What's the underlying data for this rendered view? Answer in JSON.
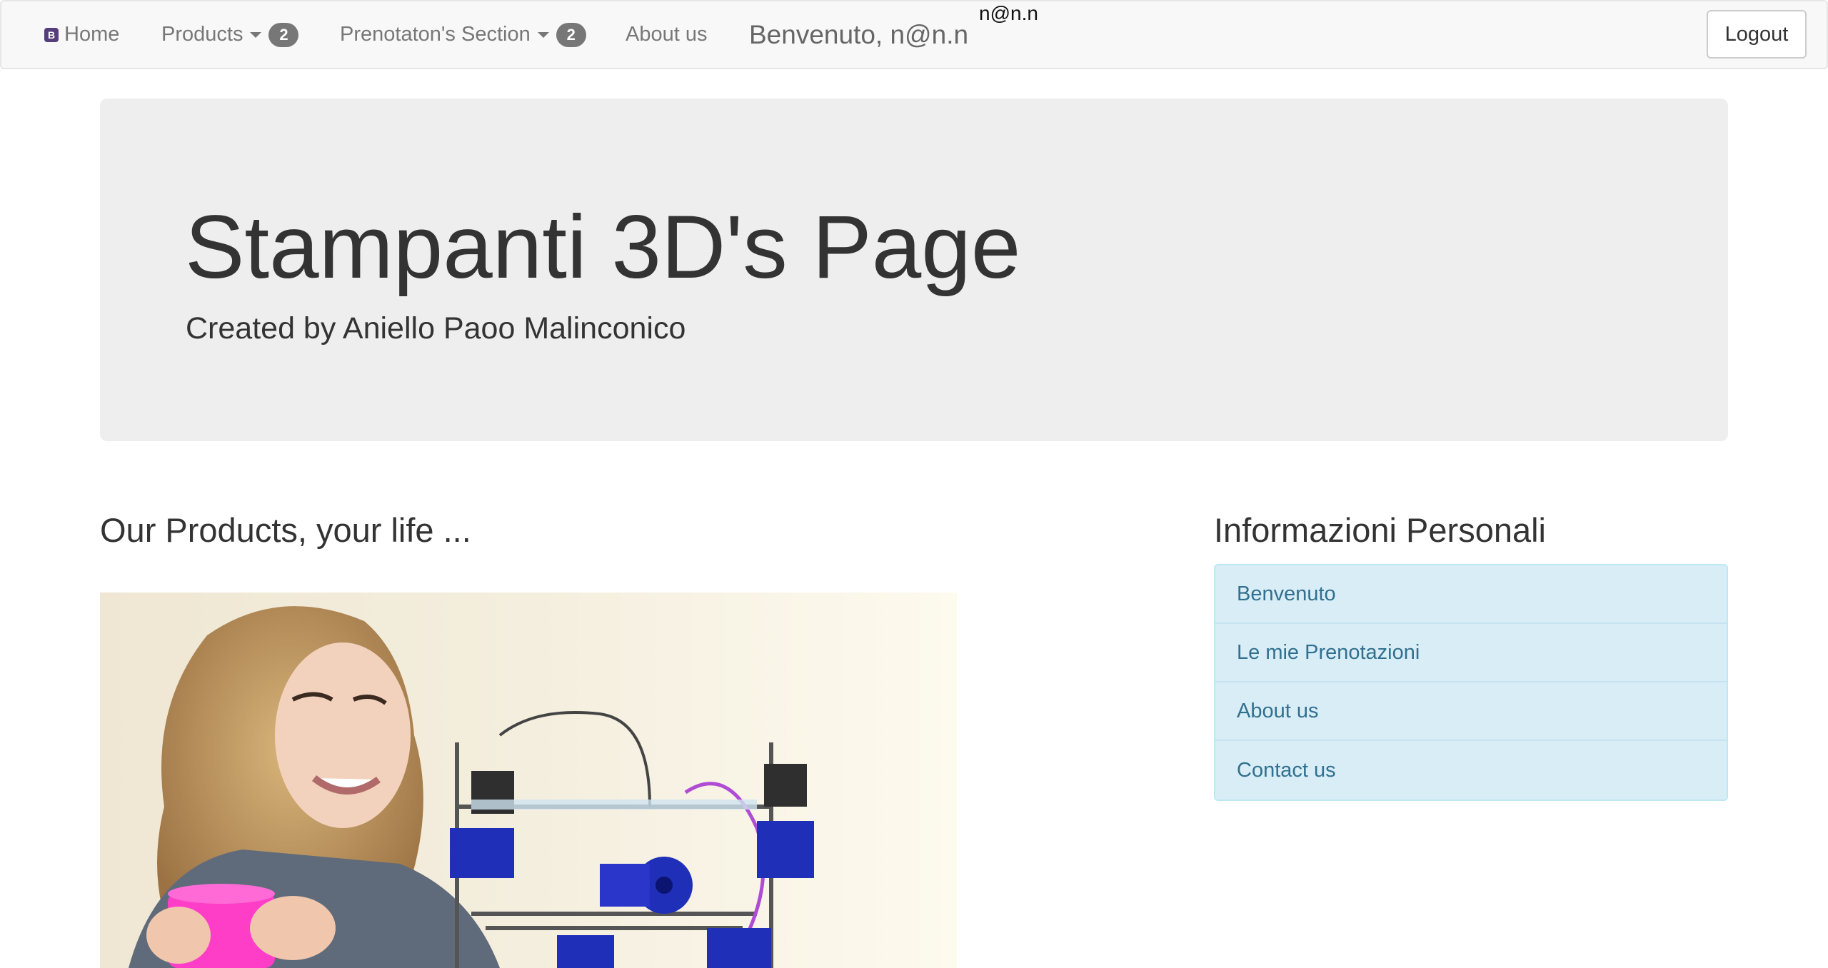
{
  "navbar": {
    "home_label": "Home",
    "products_label": "Products",
    "products_badge": "2",
    "reservations_label": "Prenotaton's Section",
    "reservations_badge": "2",
    "about_label": "About us",
    "welcome_text": "Benvenuto, n@n.n",
    "user_small": "n@n.n",
    "logout_label": "Logout"
  },
  "jumbotron": {
    "title": "Stampanti 3D's Page",
    "subtitle": "Created by Aniello Paoo Malinconico"
  },
  "products_section": {
    "heading": "Our Products, your life ..."
  },
  "info_section": {
    "heading": "Informazioni Personali",
    "items": [
      {
        "label": "Benvenuto"
      },
      {
        "label": "Le mie Prenotazioni"
      },
      {
        "label": "About us"
      },
      {
        "label": "Contact us"
      }
    ]
  },
  "colors": {
    "navbar_bg": "#f8f8f8",
    "jumbotron_bg": "#eeeeee",
    "list_bg": "#d9edf7",
    "list_text": "#31708f",
    "badge_bg": "#777777",
    "brand_icon": "#563d7c"
  },
  "icons": {
    "brand": "bootstrap-icon",
    "dropdown": "caret-down-icon"
  }
}
